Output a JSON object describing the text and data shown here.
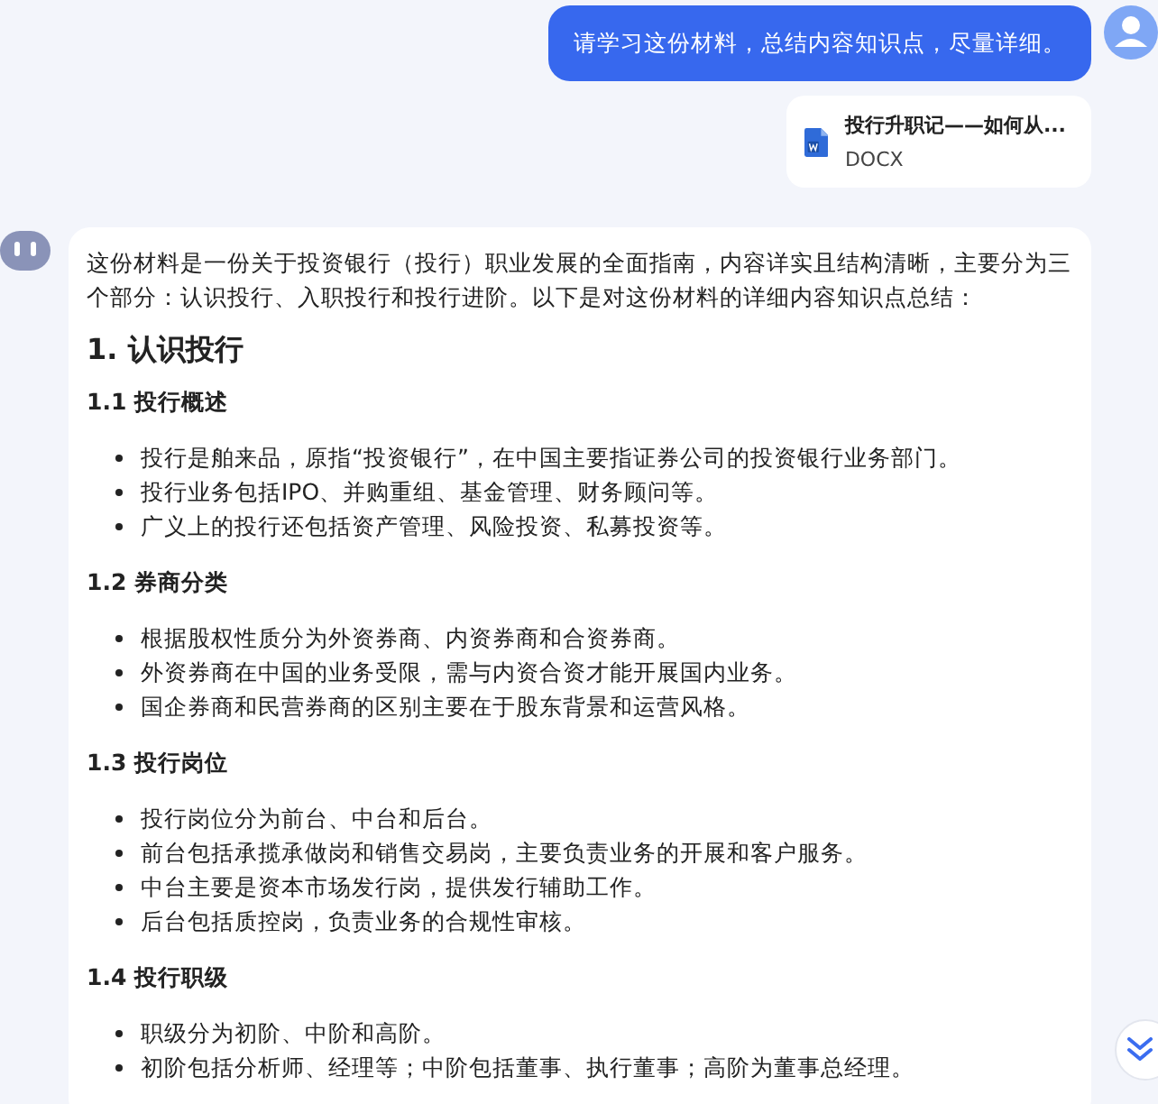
{
  "user_message": {
    "text": "请学习这份材料，总结内容知识点，尽量详细。"
  },
  "attachment": {
    "name": "投行升职记——如何从...",
    "type": "DOCX"
  },
  "answer": {
    "intro": "这份材料是一份关于投资银行（投行）职业发展的全面指南，内容详实且结构清晰，主要分为三个部分：认识投行、入职投行和投行进阶。以下是对这份材料的详细内容知识点总结：",
    "heading": "1. 认识投行",
    "sections": [
      {
        "title": "1.1 投行概述",
        "bullets": [
          "投行是舶来品，原指“投资银行”，在中国主要指证券公司的投资银行业务部门。",
          "投行业务包括IPO、并购重组、基金管理、财务顾问等。",
          "广义上的投行还包括资产管理、风险投资、私募投资等。"
        ]
      },
      {
        "title": "1.2 券商分类",
        "bullets": [
          "根据股权性质分为外资券商、内资券商和合资券商。",
          "外资券商在中国的业务受限，需与内资合资才能开展国内业务。",
          "国企券商和民营券商的区别主要在于股东背景和运营风格。"
        ]
      },
      {
        "title": "1.3 投行岗位",
        "bullets": [
          "投行岗位分为前台、中台和后台。",
          "前台包括承揽承做岗和销售交易岗，主要负责业务的开展和客户服务。",
          "中台主要是资本市场发行岗，提供发行辅助工作。",
          "后台包括质控岗，负责业务的合规性审核。"
        ]
      },
      {
        "title": "1.4 投行职级",
        "bullets": [
          "职级分为初阶、中阶和高阶。",
          "初阶包括分析师、经理等；中阶包括董事、执行董事；高阶为董事总经理。"
        ]
      }
    ]
  }
}
